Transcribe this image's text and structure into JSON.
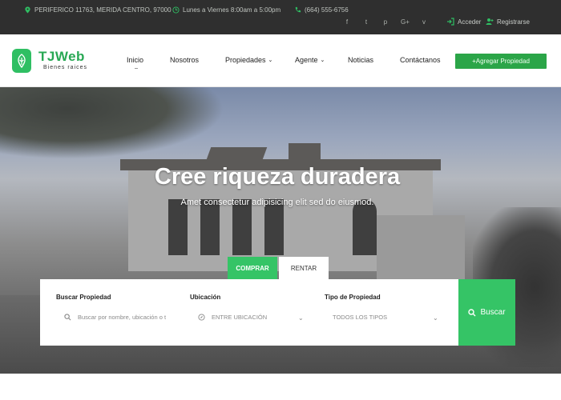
{
  "topbar": {
    "address": "PERIFERICO 11763, MERIDA CENTRO, 97000",
    "hours": "Lunes a Viernes 8:00am a 5:00pm",
    "phone": "(664) 555-6756",
    "social": [
      "f",
      "t",
      "p",
      "G+",
      "v"
    ],
    "login": "Acceder",
    "register": "Registrarse"
  },
  "brand": {
    "name": "TJWeb",
    "tagline": "Bienes raices",
    "color": "#2fbf63"
  },
  "menu": [
    {
      "label": "Inicio",
      "dropdown": false,
      "active": true
    },
    {
      "label": "Nosotros",
      "dropdown": false
    },
    {
      "label": "Propiedades",
      "dropdown": true
    },
    {
      "label": "Agente",
      "dropdown": true
    },
    {
      "label": "Noticias",
      "dropdown": false
    },
    {
      "label": "Contáctanos",
      "dropdown": false
    }
  ],
  "add_property": "+Agregar Propiedad",
  "hero": {
    "title": "Cree riqueza duradera",
    "subtitle": "Amet consectetur adipisicing elit sed do eiusmod."
  },
  "tabs": {
    "buy": "COMPRAR",
    "rent": "RENTAR"
  },
  "search": {
    "property_label": "Buscar Propiedad",
    "property_placeholder": "Buscar por nombre, ubicación o t",
    "location_label": "Ubicación",
    "location_value": "ENTRE UBICACIÓN",
    "type_label": "Tipo de Propiedad",
    "type_value": "TODOS LOS TIPOS",
    "button": "Buscar"
  },
  "colors": {
    "accent": "#35c466",
    "dark_bar": "#2f2f2f"
  }
}
